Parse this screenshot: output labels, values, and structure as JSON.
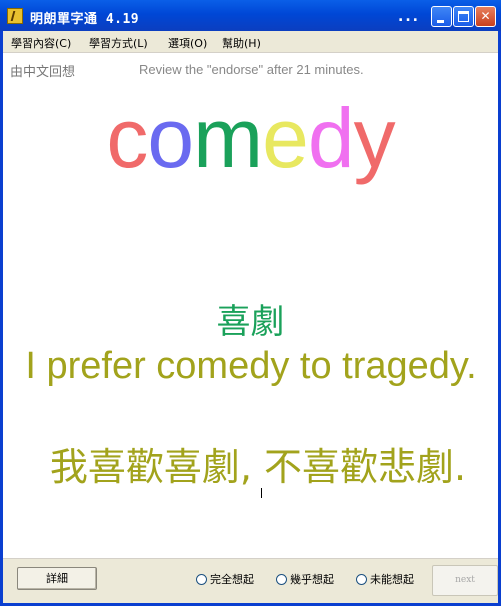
{
  "window": {
    "title": "明朗單字通 4.19",
    "extra_button": "..."
  },
  "menu": {
    "items": [
      "學習內容(C)",
      "學習方式(L)",
      "選項(O)",
      "幫助(H)"
    ]
  },
  "hints": {
    "mode": "由中文回想",
    "review": "Review the \"endorse\" after 21 minutes."
  },
  "word": {
    "letters": [
      "c",
      "o",
      "m",
      "e",
      "d",
      "y"
    ],
    "colors": [
      "#f06a6a",
      "#6a6af0",
      "#1aa15a",
      "#e8e860",
      "#f070f0",
      "#f06a6a"
    ]
  },
  "definition": {
    "chinese": "喜劇"
  },
  "example": {
    "english": "I prefer comedy to tragedy.",
    "chinese": "我喜歡喜劇, 不喜歡悲劇."
  },
  "bottom": {
    "detail_label": "詳細",
    "options": [
      "完全想起",
      "幾乎想起",
      "未能想起"
    ],
    "next_label": "next"
  }
}
